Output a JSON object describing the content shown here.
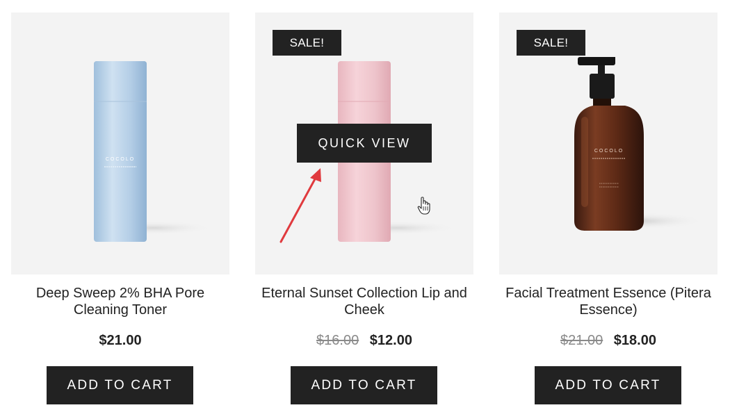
{
  "products": [
    {
      "title": "Deep Sweep 2% BHA Pore Cleaning Toner",
      "price": "$21.00",
      "add_to_cart": "ADD TO CART"
    },
    {
      "badge": "SALE!",
      "title": "Eternal Sunset Collection Lip and Cheek",
      "old_price": "$16.00",
      "price": "$12.00",
      "add_to_cart": "ADD TO CART",
      "quick_view": "QUICK VIEW"
    },
    {
      "badge": "SALE!",
      "title": "Facial Treatment Essence (Pitera Essence)",
      "old_price": "$21.00",
      "price": "$18.00",
      "add_to_cart": "ADD TO CART"
    }
  ],
  "brand_text": "COCOLO",
  "colors": {
    "button_bg": "#222222",
    "image_bg": "#f3f3f3",
    "strike_price": "#8a8a8a",
    "annotation_arrow": "#e03a3e"
  },
  "icons": [
    "hand-pointer-icon",
    "red-arrow-annotation"
  ]
}
